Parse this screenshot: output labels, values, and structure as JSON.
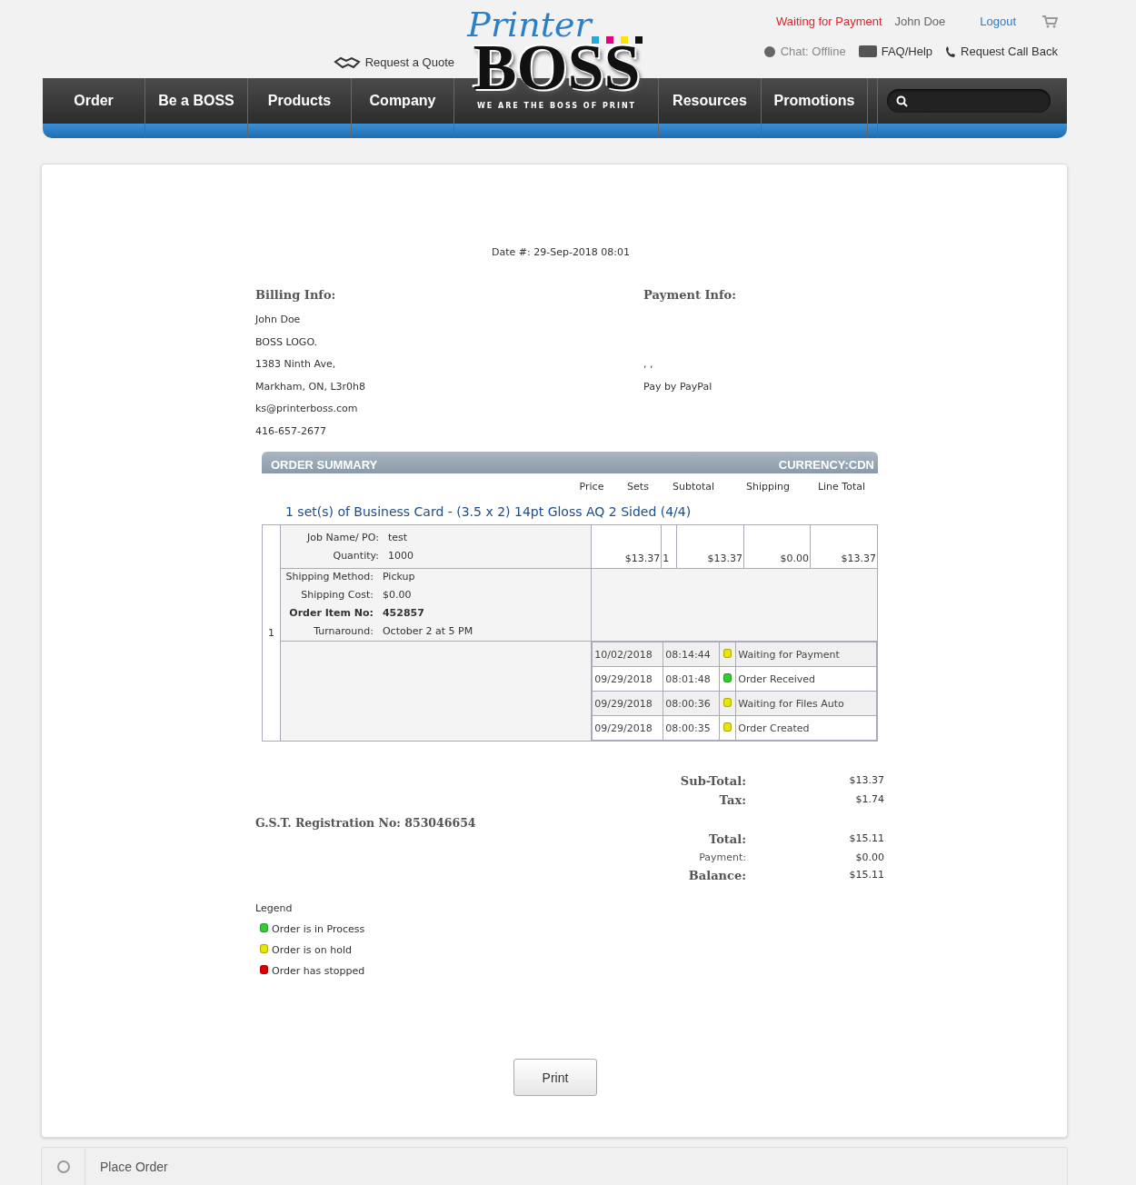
{
  "header": {
    "status": "Waiting for Payment",
    "user": "John Doe",
    "logout": "Logout",
    "quote": "Request a Quote",
    "chat": "Chat: Offline",
    "faq": "FAQ/Help",
    "callback": "Request Call Back"
  },
  "logo": {
    "script": "Printer",
    "word": "BOSS",
    "tagline": "WE ARE THE BOSS OF PRINT"
  },
  "nav": {
    "left": [
      "Order",
      "Be a BOSS",
      "Products",
      "Company"
    ],
    "right": [
      "Resources",
      "Promotions"
    ]
  },
  "invoice": {
    "date": "Date #: 29-Sep-2018 08:01"
  },
  "billing": {
    "title": "Billing Info:",
    "lines": [
      "John Doe",
      "BOSS LOGO.",
      "1383 Ninth Ave,",
      "Markham, ON, L3r0h8",
      "ks@printerboss.com",
      "416-657-2677"
    ]
  },
  "payment": {
    "title": "Payment Info:",
    "lines": [
      ", ,",
      "Pay by PayPal"
    ]
  },
  "summary": {
    "title": "ORDER SUMMARY",
    "currency": "CURRENCY:CDN",
    "columns": [
      "Price",
      "Sets",
      "Subtotal",
      "Shipping",
      "Line Total"
    ],
    "item_title": "1 set(s) of Business Card - (3.5 x 2) 14pt Gloss AQ 2 Sided (4/4)",
    "row_number": "1",
    "top_details": [
      {
        "label": "Job Name/ PO:",
        "value": "test"
      },
      {
        "label": "Quantity:",
        "value": "1000"
      }
    ],
    "values": [
      "$13.37",
      "1",
      "$13.37",
      "$0.00",
      "$13.37"
    ],
    "details": [
      {
        "label": "Shipping Method:",
        "value": "Pickup",
        "bold": false
      },
      {
        "label": "Shipping Cost:",
        "value": "$0.00",
        "bold": false
      },
      {
        "label": "Order Item No:",
        "value": "452857",
        "bold": true
      },
      {
        "label": "Turnaround:",
        "value": "October 2 at 5 PM",
        "bold": false
      }
    ],
    "history": [
      {
        "date": "10/02/2018",
        "time": "08:14:44",
        "color": "#e6e600",
        "status": "Waiting for Payment"
      },
      {
        "date": "09/29/2018",
        "time": "08:01:48",
        "color": "#33cc33",
        "status": "Order Received"
      },
      {
        "date": "09/29/2018",
        "time": "08:00:36",
        "color": "#e6e600",
        "status": "Waiting for Files Auto"
      },
      {
        "date": "09/29/2018",
        "time": "08:00:35",
        "color": "#e6e600",
        "status": "Order Created"
      }
    ]
  },
  "gst": "G.S.T. Registration No: 853046654",
  "totals": [
    {
      "rows": [
        {
          "label": "Sub-Total:",
          "value": "$13.37",
          "kind": "major"
        },
        {
          "label": "Tax:",
          "value": "$1.74",
          "kind": "major"
        }
      ]
    },
    {
      "rows": [
        {
          "label": "Total:",
          "value": "$15.11",
          "kind": "major"
        },
        {
          "label": "Payment:",
          "value": "$0.00",
          "kind": "minor"
        },
        {
          "label": "Balance:",
          "value": "$15.11",
          "kind": "major"
        }
      ]
    }
  ],
  "legend": {
    "title": "Legend",
    "items": [
      {
        "color": "#33cc33",
        "label": "Order is in Process"
      },
      {
        "color": "#e6e600",
        "label": "Order is on hold"
      },
      {
        "color": "#dd0000",
        "label": "Order has stopped"
      }
    ]
  },
  "print": "Print",
  "breadcrumb": "Place Order"
}
